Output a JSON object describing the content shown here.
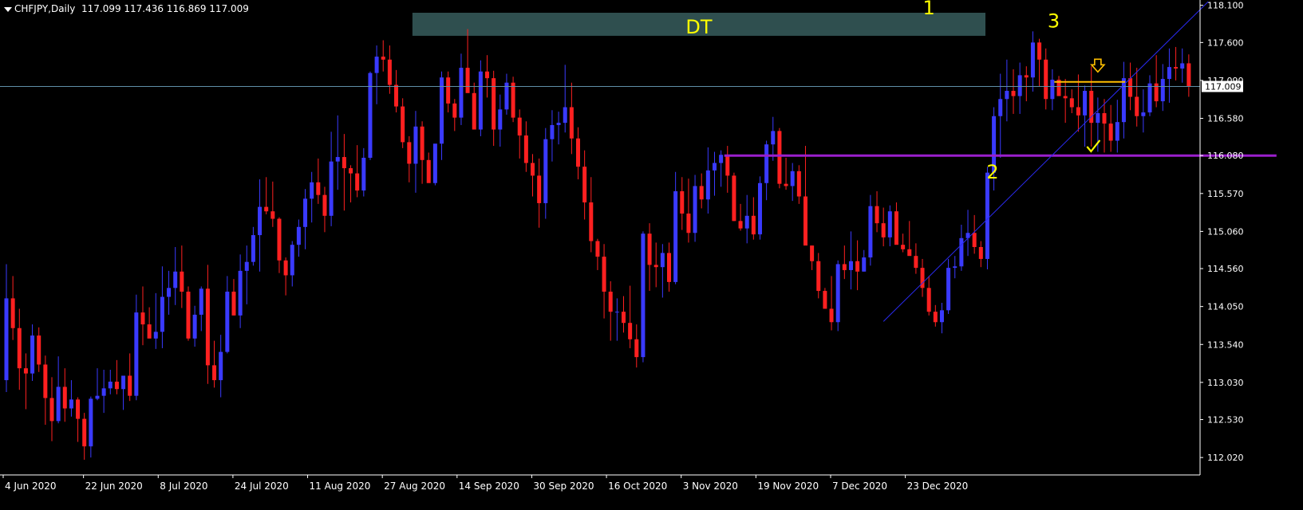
{
  "header": {
    "symbol": "CHFJPY,Daily",
    "ohlc": "117.099 117.436 116.869 117.009"
  },
  "colors": {
    "background": "#000000",
    "axis": "#ffffff",
    "bull": "#3a3aff",
    "bear": "#ff2020",
    "current_price_line": "#5f8fa7",
    "support_line": "#9a1fcc",
    "trendline": "#2a2af0",
    "zone": "#2f4f4f",
    "annotation": "#ffff00",
    "sell_level": "#ffbf00"
  },
  "chart_data": {
    "type": "candlestick",
    "symbol": "CHFJPY",
    "timeframe": "Daily",
    "ylim": [
      111.85,
      118.15
    ],
    "y_ticks": [
      "118.100",
      "117.600",
      "117.090",
      "116.580",
      "116.080",
      "115.570",
      "115.060",
      "114.560",
      "114.050",
      "113.540",
      "113.030",
      "112.530",
      "112.020"
    ],
    "x_tick_labels": [
      "4 Jun 2020",
      "22 Jun 2020",
      "8 Jul 2020",
      "24 Jul 2020",
      "11 Aug 2020",
      "27 Aug 2020",
      "14 Sep 2020",
      "30 Sep 2020",
      "16 Oct 2020",
      "3 Nov 2020",
      "19 Nov 2020",
      "7 Dec 2020",
      "23 Dec 2020"
    ],
    "current_price": "117.009",
    "annotations": {
      "zone_label": "DT",
      "peak1": "1",
      "trough2": "2",
      "peak3": "3",
      "check": "✓",
      "arrow": "⇩"
    },
    "levels": {
      "support": 116.08,
      "sell_entry": 117.07,
      "zone_low": 117.69,
      "zone_high": 118.0
    },
    "trendline": {
      "from": {
        "bar": 135,
        "price": 113.85
      },
      "to": {
        "bar": 185,
        "price": 118.15
      }
    },
    "candles": [
      [
        113.06,
        114.62,
        112.9,
        114.16
      ],
      [
        114.16,
        114.46,
        113.6,
        113.76
      ],
      [
        113.76,
        114.02,
        112.93,
        113.22
      ],
      [
        113.22,
        113.42,
        112.67,
        113.15
      ],
      [
        113.15,
        113.81,
        113.05,
        113.66
      ],
      [
        113.66,
        113.77,
        113.17,
        113.27
      ],
      [
        113.27,
        113.39,
        112.46,
        112.82
      ],
      [
        112.82,
        113.1,
        112.24,
        112.51
      ],
      [
        112.51,
        113.38,
        112.48,
        112.97
      ],
      [
        112.97,
        113.22,
        112.5,
        112.68
      ],
      [
        112.68,
        113.06,
        112.57,
        112.8
      ],
      [
        112.8,
        112.83,
        112.23,
        112.54
      ],
      [
        112.54,
        112.62,
        111.99,
        112.17
      ],
      [
        112.17,
        112.84,
        112.02,
        112.81
      ],
      [
        112.81,
        113.22,
        112.79,
        112.85
      ],
      [
        112.85,
        113.2,
        112.62,
        112.95
      ],
      [
        112.95,
        113.2,
        112.87,
        113.04
      ],
      [
        113.04,
        113.33,
        112.87,
        112.94
      ],
      [
        112.94,
        113.1,
        112.66,
        113.12
      ],
      [
        113.12,
        113.42,
        112.78,
        112.85
      ],
      [
        112.85,
        114.21,
        112.79,
        113.97
      ],
      [
        113.97,
        114.32,
        113.53,
        113.81
      ],
      [
        113.81,
        114.04,
        113.66,
        113.62
      ],
      [
        113.62,
        114.23,
        113.48,
        113.71
      ],
      [
        113.71,
        114.59,
        113.49,
        114.18
      ],
      [
        114.18,
        114.53,
        113.94,
        114.3
      ],
      [
        114.3,
        114.85,
        114.07,
        114.52
      ],
      [
        114.52,
        114.87,
        114.03,
        114.25
      ],
      [
        114.25,
        114.32,
        113.59,
        113.62
      ],
      [
        113.62,
        114.06,
        113.51,
        113.94
      ],
      [
        113.94,
        114.32,
        113.72,
        114.29
      ],
      [
        114.29,
        114.61,
        113.01,
        113.26
      ],
      [
        113.26,
        113.59,
        112.96,
        113.06
      ],
      [
        113.06,
        113.67,
        112.83,
        113.44
      ],
      [
        113.44,
        114.46,
        113.42,
        114.25
      ],
      [
        114.25,
        114.42,
        113.93,
        113.93
      ],
      [
        113.93,
        114.75,
        113.76,
        114.53
      ],
      [
        114.53,
        114.87,
        114.08,
        114.65
      ],
      [
        114.65,
        115.12,
        114.6,
        115.01
      ],
      [
        115.01,
        115.76,
        114.52,
        115.39
      ],
      [
        115.39,
        115.79,
        115.29,
        115.33
      ],
      [
        115.33,
        115.73,
        115.12,
        115.23
      ],
      [
        115.23,
        115.25,
        114.5,
        114.67
      ],
      [
        114.67,
        114.71,
        114.2,
        114.47
      ],
      [
        114.47,
        114.93,
        114.32,
        114.88
      ],
      [
        114.88,
        115.22,
        114.72,
        115.12
      ],
      [
        115.12,
        115.63,
        114.82,
        115.5
      ],
      [
        115.5,
        115.86,
        115.18,
        115.72
      ],
      [
        115.72,
        116.04,
        115.43,
        115.55
      ],
      [
        115.55,
        115.66,
        115.05,
        115.27
      ],
      [
        115.27,
        116.4,
        115.13,
        116.0
      ],
      [
        116.0,
        116.62,
        115.62,
        116.06
      ],
      [
        116.06,
        116.37,
        115.34,
        115.91
      ],
      [
        115.91,
        115.95,
        115.45,
        115.84
      ],
      [
        115.84,
        116.22,
        115.52,
        115.61
      ],
      [
        115.61,
        116.18,
        115.53,
        116.05
      ],
      [
        116.05,
        117.21,
        116.02,
        117.19
      ],
      [
        117.19,
        117.56,
        116.77,
        117.41
      ],
      [
        117.41,
        117.63,
        117.21,
        117.37
      ],
      [
        117.37,
        117.56,
        116.91,
        117.03
      ],
      [
        117.03,
        117.23,
        116.66,
        116.74
      ],
      [
        116.74,
        116.85,
        116.18,
        116.26
      ],
      [
        116.26,
        116.34,
        115.72,
        115.97
      ],
      [
        115.97,
        116.68,
        115.58,
        116.47
      ],
      [
        116.47,
        116.54,
        115.7,
        116.02
      ],
      [
        116.02,
        116.12,
        115.87,
        115.71
      ],
      [
        115.71,
        116.12,
        115.68,
        116.24
      ],
      [
        116.24,
        117.21,
        116.02,
        117.13
      ],
      [
        117.13,
        117.21,
        116.66,
        116.78
      ],
      [
        116.78,
        116.84,
        116.41,
        116.59
      ],
      [
        116.59,
        117.45,
        116.49,
        117.26
      ],
      [
        117.26,
        117.78,
        117.01,
        116.92
      ],
      [
        116.92,
        117.06,
        116.56,
        116.43
      ],
      [
        116.43,
        117.36,
        116.34,
        117.21
      ],
      [
        117.21,
        117.43,
        116.86,
        117.12
      ],
      [
        117.12,
        117.22,
        116.21,
        116.43
      ],
      [
        116.43,
        116.9,
        116.2,
        116.7
      ],
      [
        116.7,
        117.18,
        116.63,
        117.06
      ],
      [
        117.06,
        117.14,
        116.53,
        116.59
      ],
      [
        116.59,
        116.7,
        116.04,
        116.35
      ],
      [
        116.35,
        116.54,
        115.86,
        115.98
      ],
      [
        115.98,
        116.1,
        115.53,
        115.81
      ],
      [
        115.81,
        116.04,
        115.11,
        115.44
      ],
      [
        115.44,
        116.45,
        115.23,
        116.3
      ],
      [
        116.3,
        116.69,
        116.0,
        116.49
      ],
      [
        116.49,
        116.67,
        116.23,
        116.52
      ],
      [
        116.52,
        117.3,
        116.39,
        116.73
      ],
      [
        116.73,
        117.06,
        116.1,
        116.31
      ],
      [
        116.31,
        116.46,
        115.76,
        115.93
      ],
      [
        115.93,
        116.15,
        115.22,
        115.45
      ],
      [
        115.45,
        115.79,
        114.78,
        114.93
      ],
      [
        114.93,
        114.96,
        114.54,
        114.72
      ],
      [
        114.72,
        114.89,
        113.89,
        114.25
      ],
      [
        114.25,
        114.39,
        113.59,
        113.98
      ],
      [
        113.98,
        114.16,
        113.59,
        113.98
      ],
      [
        113.98,
        114.19,
        113.7,
        113.83
      ],
      [
        113.83,
        114.33,
        113.49,
        113.61
      ],
      [
        113.61,
        113.81,
        113.23,
        113.37
      ],
      [
        113.37,
        115.06,
        113.3,
        115.03
      ],
      [
        115.03,
        115.17,
        114.26,
        114.61
      ],
      [
        114.61,
        114.91,
        114.31,
        114.58
      ],
      [
        114.58,
        114.89,
        114.17,
        114.77
      ],
      [
        114.77,
        114.91,
        114.25,
        114.38
      ],
      [
        114.38,
        115.86,
        114.35,
        115.6
      ],
      [
        115.6,
        115.79,
        115.08,
        115.3
      ],
      [
        115.3,
        115.77,
        114.91,
        115.04
      ],
      [
        115.04,
        115.82,
        114.92,
        115.67
      ],
      [
        115.67,
        115.84,
        115.37,
        115.49
      ],
      [
        115.49,
        116.19,
        115.3,
        115.88
      ],
      [
        115.88,
        116.13,
        115.54,
        115.98
      ],
      [
        115.98,
        116.15,
        115.66,
        116.09
      ],
      [
        116.09,
        116.21,
        115.58,
        115.81
      ],
      [
        115.81,
        115.85,
        115.2,
        115.2
      ],
      [
        115.2,
        115.43,
        115.07,
        115.1
      ],
      [
        115.1,
        115.55,
        114.9,
        115.27
      ],
      [
        115.27,
        115.52,
        114.95,
        115.02
      ],
      [
        115.02,
        115.8,
        114.95,
        115.71
      ],
      [
        115.71,
        116.28,
        115.48,
        116.23
      ],
      [
        116.23,
        116.6,
        116.01,
        116.41
      ],
      [
        116.41,
        116.45,
        115.64,
        115.7
      ],
      [
        115.7,
        116.05,
        115.62,
        115.67
      ],
      [
        115.67,
        115.98,
        115.47,
        115.87
      ],
      [
        115.87,
        115.95,
        115.43,
        115.53
      ],
      [
        115.53,
        116.21,
        115.2,
        114.87
      ],
      [
        114.87,
        114.87,
        114.54,
        114.66
      ],
      [
        114.66,
        114.77,
        114.16,
        114.26
      ],
      [
        114.26,
        114.3,
        114.08,
        114.02
      ],
      [
        114.02,
        114.46,
        113.73,
        113.84
      ],
      [
        113.84,
        114.67,
        113.72,
        114.62
      ],
      [
        114.62,
        114.87,
        114.42,
        114.54
      ],
      [
        114.54,
        115.06,
        114.28,
        114.66
      ],
      [
        114.66,
        114.94,
        114.27,
        114.52
      ],
      [
        114.52,
        114.81,
        114.52,
        114.71
      ],
      [
        114.71,
        115.55,
        114.6,
        115.4
      ],
      [
        115.4,
        115.6,
        115.05,
        115.17
      ],
      [
        115.17,
        115.38,
        114.86,
        114.98
      ],
      [
        114.98,
        115.41,
        114.86,
        115.33
      ],
      [
        115.33,
        115.45,
        114.94,
        114.88
      ],
      [
        114.88,
        115.03,
        114.78,
        114.82
      ],
      [
        114.82,
        115.2,
        114.76,
        114.73
      ],
      [
        114.73,
        114.9,
        114.49,
        114.57
      ],
      [
        114.57,
        114.69,
        114.18,
        114.3
      ],
      [
        114.3,
        114.46,
        113.93,
        113.98
      ],
      [
        113.98,
        114.07,
        113.78,
        113.84
      ],
      [
        113.84,
        114.1,
        113.69,
        114.0
      ],
      [
        114.0,
        114.69,
        113.95,
        114.57
      ],
      [
        114.57,
        114.73,
        114.43,
        114.59
      ],
      [
        114.59,
        115.15,
        114.53,
        114.97
      ],
      [
        114.97,
        115.35,
        114.73,
        115.04
      ],
      [
        115.04,
        115.28,
        114.76,
        114.85
      ],
      [
        114.85,
        114.93,
        114.58,
        114.69
      ],
      [
        114.69,
        115.93,
        114.55,
        115.85
      ],
      [
        115.85,
        116.73,
        115.61,
        116.61
      ],
      [
        116.61,
        117.18,
        116.05,
        116.84
      ],
      [
        116.84,
        117.37,
        116.54,
        116.95
      ],
      [
        116.95,
        117.24,
        116.64,
        116.88
      ],
      [
        116.88,
        117.33,
        116.64,
        117.16
      ],
      [
        117.16,
        117.28,
        116.81,
        117.13
      ],
      [
        117.13,
        117.75,
        116.94,
        117.6
      ],
      [
        117.6,
        117.65,
        117.01,
        117.37
      ],
      [
        117.37,
        117.52,
        116.7,
        116.84
      ],
      [
        116.84,
        117.24,
        116.69,
        117.1
      ],
      [
        117.1,
        117.15,
        116.89,
        116.88
      ],
      [
        116.88,
        117.11,
        116.52,
        116.85
      ],
      [
        116.85,
        116.97,
        116.65,
        116.73
      ],
      [
        116.73,
        117.17,
        116.4,
        116.62
      ],
      [
        116.62,
        117.02,
        116.2,
        116.95
      ],
      [
        116.95,
        117.28,
        116.2,
        116.52
      ],
      [
        116.52,
        116.86,
        116.13,
        116.65
      ],
      [
        116.65,
        116.84,
        116.12,
        116.51
      ],
      [
        116.51,
        116.76,
        116.13,
        116.28
      ],
      [
        116.28,
        116.83,
        116.12,
        116.53
      ],
      [
        116.53,
        117.34,
        116.31,
        117.12
      ],
      [
        117.12,
        117.33,
        116.69,
        116.87
      ],
      [
        116.87,
        117.26,
        116.47,
        116.61
      ],
      [
        116.61,
        116.97,
        116.39,
        116.66
      ],
      [
        116.66,
        117.16,
        116.61,
        117.05
      ],
      [
        117.05,
        117.43,
        116.73,
        116.81
      ],
      [
        116.81,
        117.31,
        116.68,
        117.11
      ],
      [
        117.11,
        117.52,
        116.79,
        117.27
      ],
      [
        117.27,
        117.54,
        117.09,
        117.25
      ],
      [
        117.25,
        117.52,
        117.06,
        117.32
      ],
      [
        117.32,
        117.44,
        116.87,
        117.01
      ]
    ]
  }
}
